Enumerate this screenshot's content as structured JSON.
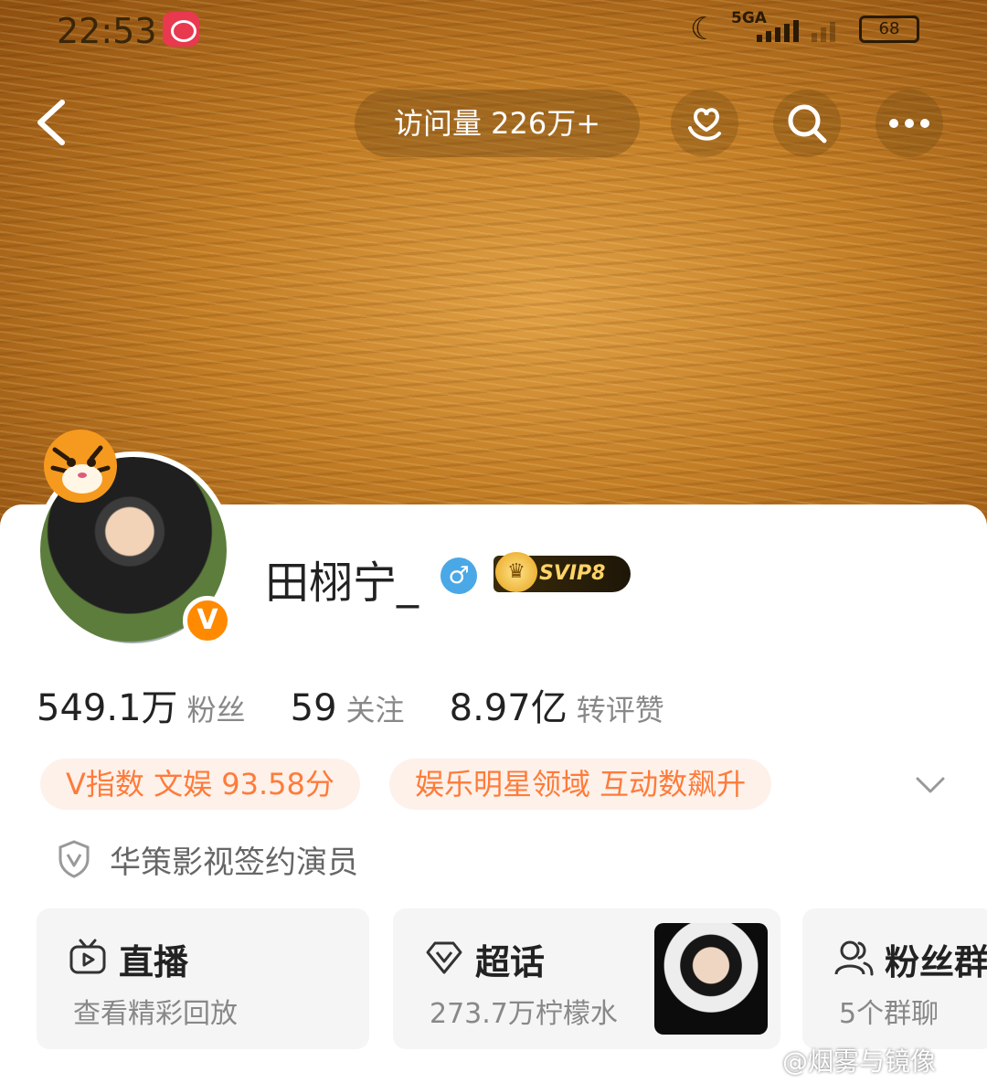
{
  "status_bar": {
    "time": "22:53",
    "network": "5GA",
    "battery": "68"
  },
  "nav": {
    "back_icon": "back-arrow-icon",
    "visits": "访问量 226万+",
    "icons": [
      "hand-heart-icon",
      "search-icon",
      "more-icon"
    ]
  },
  "profile": {
    "nickname": "田栩宁_",
    "gender_symbol": "♂",
    "vip_label": "SVIP8",
    "verified_badge": "V",
    "stats": [
      {
        "value": "549.1万",
        "label": "粉丝"
      },
      {
        "value": "59",
        "label": "关注"
      },
      {
        "value": "8.97亿",
        "label": "转评赞"
      }
    ],
    "tags": [
      "V指数 文娱 93.58分",
      "娱乐明星领域 互动数飙升"
    ],
    "certification": "华策影视签约演员"
  },
  "tiles": [
    {
      "title": "直播",
      "subtitle": "查看精彩回放",
      "icon": "tv-icon"
    },
    {
      "title": "超话",
      "subtitle": "273.7万柠檬水",
      "icon": "diamond-icon"
    },
    {
      "title": "粉丝群",
      "subtitle": "5个群聊",
      "icon": "group-icon"
    }
  ],
  "watermark": "@烟雾与镜像",
  "colors": {
    "accent_orange": "#ff7b3a",
    "tag_bg": "#fdf1ea",
    "verified_orange": "#ff8a00"
  }
}
